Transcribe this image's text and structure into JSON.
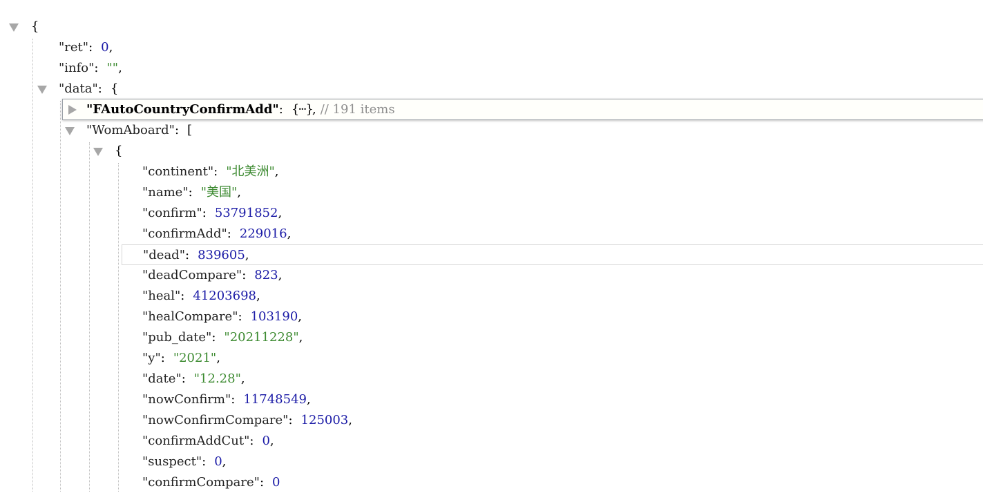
{
  "root": {
    "open_brace": "{"
  },
  "fields": {
    "ret": {
      "key": "\"ret\"",
      "value": "0"
    },
    "info": {
      "key": "\"info\"",
      "value": "\"\""
    },
    "data": {
      "key": "\"data\"",
      "open": "{"
    }
  },
  "data": {
    "fauto": {
      "key": "\"FAutoCountryConfirmAdd\"",
      "collapsed": "{···}",
      "comment": "// 191 items"
    },
    "womaboard": {
      "key": "\"WomAboard\"",
      "open": "["
    },
    "item_open": "{",
    "item": [
      {
        "key": "\"continent\"",
        "value": "\"北美洲\"",
        "type": "str"
      },
      {
        "key": "\"name\"",
        "value": "\"美国\"",
        "type": "str"
      },
      {
        "key": "\"confirm\"",
        "value": "53791852",
        "type": "num"
      },
      {
        "key": "\"confirmAdd\"",
        "value": "229016",
        "type": "num"
      },
      {
        "key": "\"dead\"",
        "value": "839605",
        "type": "num"
      },
      {
        "key": "\"deadCompare\"",
        "value": "823",
        "type": "num"
      },
      {
        "key": "\"heal\"",
        "value": "41203698",
        "type": "num"
      },
      {
        "key": "\"healCompare\"",
        "value": "103190",
        "type": "num"
      },
      {
        "key": "\"pub_date\"",
        "value": "\"20211228\"",
        "type": "str"
      },
      {
        "key": "\"y\"",
        "value": "\"2021\"",
        "type": "str"
      },
      {
        "key": "\"date\"",
        "value": "\"12.28\"",
        "type": "str"
      },
      {
        "key": "\"nowConfirm\"",
        "value": "11748549",
        "type": "num"
      },
      {
        "key": "\"nowConfirmCompare\"",
        "value": "125003",
        "type": "num"
      },
      {
        "key": "\"confirmAddCut\"",
        "value": "0",
        "type": "num"
      },
      {
        "key": "\"suspect\"",
        "value": "0",
        "type": "num"
      },
      {
        "key": "\"confirmCompare\"",
        "value": "0",
        "type": "num"
      }
    ]
  },
  "colors": {
    "number": "#1a1aa6",
    "string": "#3c8a30",
    "comment": "#8f8f8f",
    "toggle": "#a7a7a7"
  },
  "icons": [
    "expand-triangle-icon",
    "collapse-triangle-icon"
  ]
}
